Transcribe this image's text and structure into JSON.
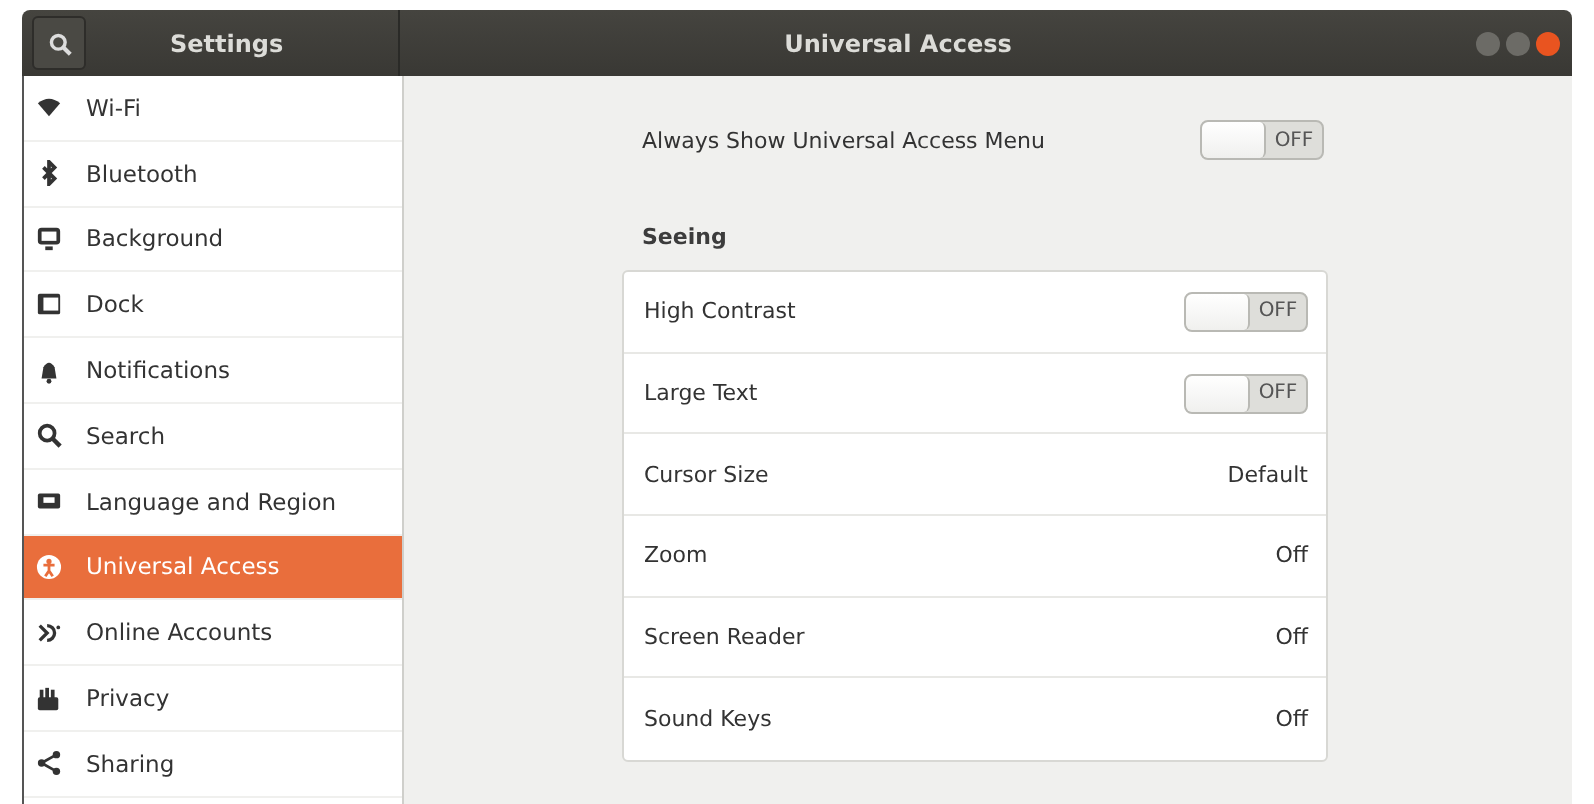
{
  "header": {
    "app_title": "Settings",
    "title": "Universal Access"
  },
  "sidebar": {
    "items": [
      {
        "label": "Wi-Fi",
        "selected": false
      },
      {
        "label": "Bluetooth",
        "selected": false
      },
      {
        "label": "Background",
        "selected": false
      },
      {
        "label": "Dock",
        "selected": false
      },
      {
        "label": "Notifications",
        "selected": false
      },
      {
        "label": "Search",
        "selected": false
      },
      {
        "label": "Language and Region",
        "selected": false
      },
      {
        "label": "Universal Access",
        "selected": true
      },
      {
        "label": "Online Accounts",
        "selected": false
      },
      {
        "label": "Privacy",
        "selected": false
      },
      {
        "label": "Sharing",
        "selected": false
      }
    ]
  },
  "always_show": {
    "label": "Always Show Universal Access Menu",
    "on": false,
    "state_text": "OFF"
  },
  "seeing": {
    "heading": "Seeing",
    "rows": [
      {
        "kind": "switch",
        "label": "High Contrast",
        "on": false,
        "state_text": "OFF"
      },
      {
        "kind": "switch",
        "label": "Large Text",
        "on": false,
        "state_text": "OFF"
      },
      {
        "kind": "value",
        "label": "Cursor Size",
        "value": "Default"
      },
      {
        "kind": "value",
        "label": "Zoom",
        "value": "Off"
      },
      {
        "kind": "value",
        "label": "Screen Reader",
        "value": "Off"
      },
      {
        "kind": "value",
        "label": "Sound Keys",
        "value": "Off"
      }
    ]
  }
}
